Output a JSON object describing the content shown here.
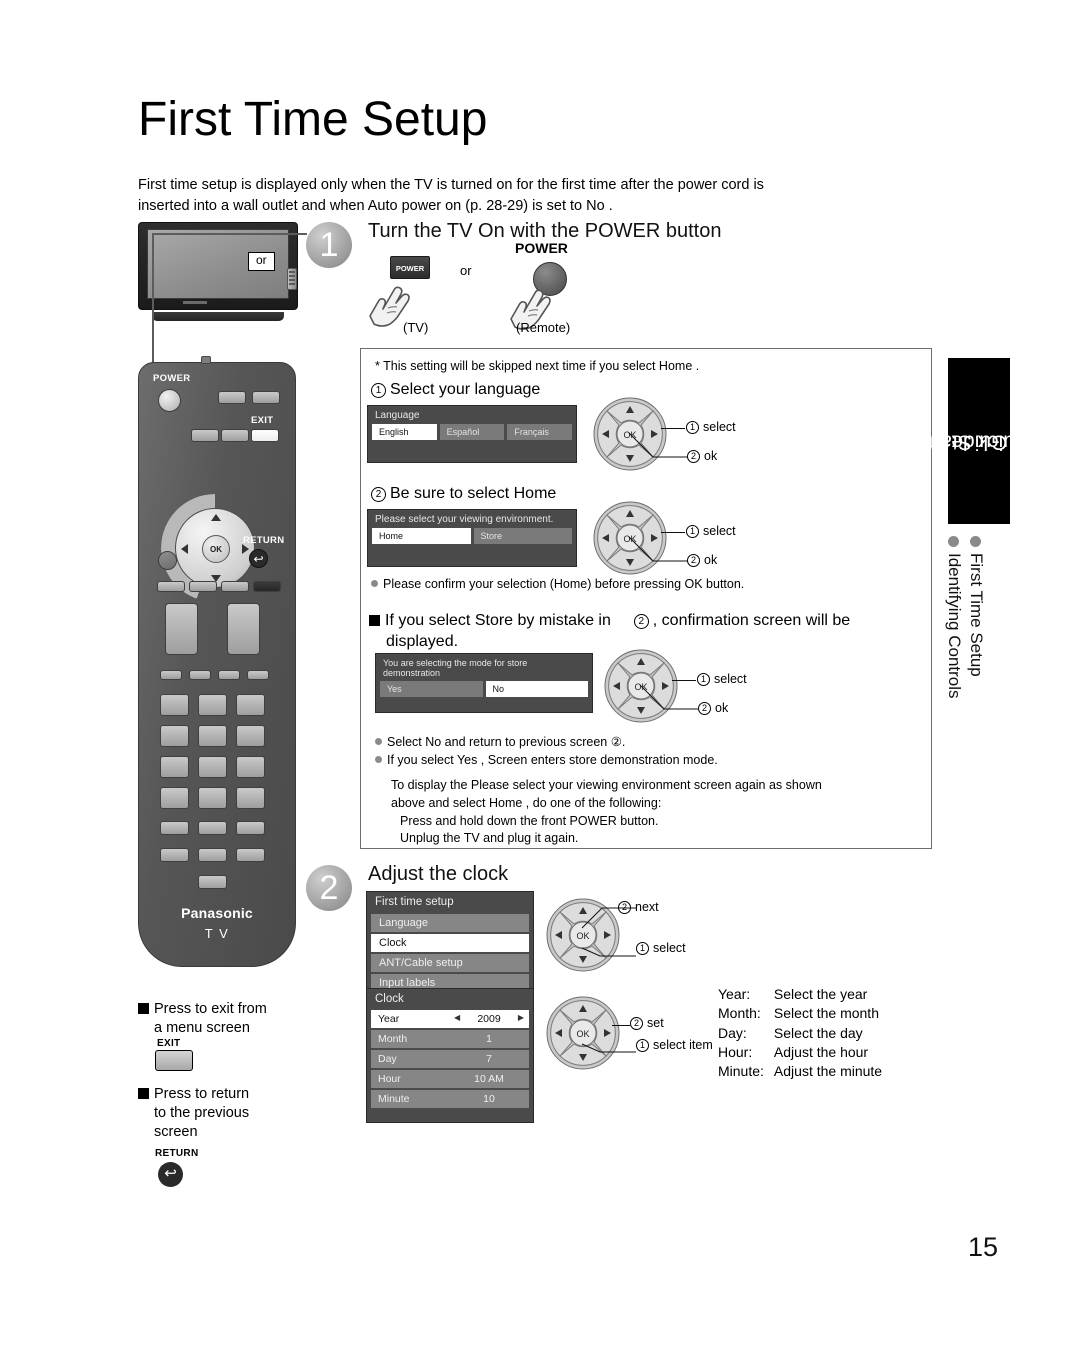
{
  "document": {
    "page_title": "First Time Setup",
    "page_number": "15",
    "intro_line1": "First time setup  is displayed only when the TV is turned on for the first time after the power cord is",
    "intro_line2": "inserted into a wall outlet and when  Auto power on  (p. 28-29) is set to  No ."
  },
  "side_tab": {
    "black_label_line1": "Quick Start",
    "black_label_line2": "Guide",
    "items": [
      {
        "label": "First Time Setup"
      },
      {
        "label": "Identifying Controls"
      }
    ]
  },
  "tv_illustration": {
    "or_label": "or"
  },
  "remote_illustration": {
    "power_label": "POWER",
    "exit_label": "EXIT",
    "return_label": "RETURN",
    "ok_label": "OK",
    "brand": "Panasonic",
    "model_label": "T V"
  },
  "step1": {
    "number": "1",
    "heading": "Turn the TV On with the POWER button",
    "tv_key_label": "POWER",
    "remote_key_label": "POWER",
    "or_label": "or",
    "tv_caption": "(TV)",
    "remote_caption": "(Remote)",
    "footnote": "*  This setting will be skipped next time if you select  Home .",
    "sub1": {
      "num": "1",
      "heading": "Select your language",
      "osd": {
        "title": "Language",
        "options": [
          "English",
          "Español",
          "Français"
        ],
        "selected": "English"
      },
      "dpad_notes": {
        "select": "select",
        "ok": "ok",
        "select_num": "1",
        "ok_num": "2"
      }
    },
    "sub2": {
      "num": "2",
      "heading": "Be sure to select  Home",
      "osd": {
        "title": "Please select your viewing environment.",
        "options": [
          "Home",
          "Store"
        ],
        "selected": "Home"
      },
      "dpad_notes": {
        "select": "select",
        "ok": "ok",
        "select_num": "1",
        "ok_num": "2"
      },
      "bullet": "Please confirm your selection (Home) before pressing OK button."
    },
    "store_warning": {
      "heading_line1": "If you select  Store  by mistake in",
      "heading_circ": "2",
      "heading_line1b": ", confirmation screen will be",
      "heading_line2": "displayed.",
      "osd": {
        "title": "You are selecting the mode for store demonstration",
        "options": [
          "Yes",
          "No"
        ],
        "selected": "No"
      },
      "dpad_notes": {
        "select": "select",
        "ok": "ok",
        "select_num": "1",
        "ok_num": "2"
      },
      "bullets": [
        "Select  No  and return to previous screen  ②.",
        "If you select  Yes , Screen enters store demonstration mode."
      ],
      "paragraph": [
        "To display the  Please select your viewing environment  screen again as shown",
        "above and select  Home , do one of the following:",
        "Press and hold down the front POWER button.",
        "Unplug the TV and plug it again."
      ]
    }
  },
  "step2": {
    "number": "2",
    "heading": "Adjust the clock",
    "menu": {
      "title": "First time setup",
      "items": [
        "Language",
        "Clock",
        "ANT/Cable setup",
        "Input labels"
      ],
      "selected": "Clock"
    },
    "menu_dpad_notes": {
      "next": "next",
      "select": "select",
      "next_num": "2",
      "select_num": "1"
    },
    "clock_osd": {
      "title": "Clock",
      "rows": [
        {
          "key": "Year",
          "value": "2009",
          "selected": true,
          "arrows": true
        },
        {
          "key": "Month",
          "value": "1",
          "selected": false,
          "arrows": false
        },
        {
          "key": "Day",
          "value": "7",
          "selected": false,
          "arrows": false
        },
        {
          "key": "Hour",
          "value": "10 AM",
          "selected": false,
          "arrows": false
        },
        {
          "key": "Minute",
          "value": "10",
          "selected": false,
          "arrows": false
        }
      ]
    },
    "clock_dpad_notes": {
      "set": "set",
      "select_item": "select item",
      "set_num": "2",
      "select_num": "1"
    },
    "descriptions": [
      {
        "key": "Year:",
        "text": "Select the year"
      },
      {
        "key": "Month:",
        "text": "Select the month"
      },
      {
        "key": "Day:",
        "text": "Select the day"
      },
      {
        "key": "Hour:",
        "text": "Adjust the hour"
      },
      {
        "key": "Minute:",
        "text": "Adjust the minute"
      }
    ]
  },
  "bottom_notes": {
    "exit": {
      "line1": "Press to exit from",
      "line2": "a menu screen",
      "key_label": "EXIT"
    },
    "return": {
      "line1": "Press to return",
      "line2": "to the previous",
      "line3": "screen",
      "key_label": "RETURN",
      "icon": "↰"
    }
  }
}
